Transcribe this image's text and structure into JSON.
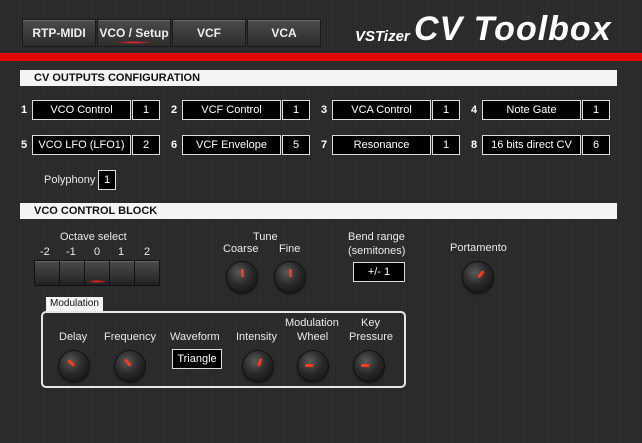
{
  "header": {
    "tabs": [
      {
        "label": "RTP-MIDI"
      },
      {
        "label": "VCO / Setup"
      },
      {
        "label": "VCF"
      },
      {
        "label": "VCA"
      }
    ],
    "brand_small": "VSTizer",
    "brand_big": "CV Toolbox",
    "accent_color": "#e00808"
  },
  "cv_outputs": {
    "title": "CV OUTPUTS CONFIGURATION",
    "rows": [
      {
        "num": "1",
        "name": "VCO Control",
        "channel": "1"
      },
      {
        "num": "2",
        "name": "VCF Control",
        "channel": "1"
      },
      {
        "num": "3",
        "name": "VCA Control",
        "channel": "1"
      },
      {
        "num": "4",
        "name": "Note Gate",
        "channel": "1"
      },
      {
        "num": "5",
        "name": "VCO LFO (LFO1)",
        "channel": "2"
      },
      {
        "num": "6",
        "name": "VCF Envelope",
        "channel": "5"
      },
      {
        "num": "7",
        "name": "Resonance",
        "channel": "1"
      },
      {
        "num": "8",
        "name": "16 bits direct CV",
        "channel": "6"
      }
    ],
    "polyphony_label": "Polyphony",
    "polyphony_value": "1"
  },
  "vco_block": {
    "title": "VCO CONTROL BLOCK",
    "octave_label": "Octave select",
    "octave_values": [
      "-2",
      "-1",
      "0",
      "1",
      "2"
    ],
    "octave_selected": "0",
    "tune_label": "Tune",
    "coarse_label": "Coarse",
    "fine_label": "Fine",
    "bend_label_1": "Bend range",
    "bend_label_2": "(semitones)",
    "bend_value": "+/- 1",
    "portamento_label": "Portamento"
  },
  "modulation": {
    "tag": "Modulation",
    "delay_label": "Delay",
    "frequency_label": "Frequency",
    "waveform_label": "Waveform",
    "waveform_value": "Triangle",
    "intensity_label": "Intensity",
    "modwheel_label_1": "Modulation",
    "modwheel_label_2": "Wheel",
    "keypressure_label_1": "Key",
    "keypressure_label_2": "Pressure"
  }
}
